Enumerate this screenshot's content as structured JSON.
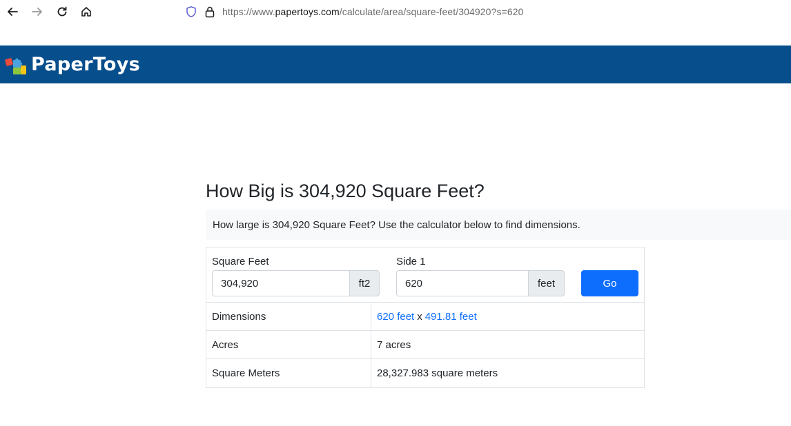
{
  "browser": {
    "url_prefix": "https://www.",
    "url_host": "papertoys.com",
    "url_path": "/calculate/area/square-feet/304920?s=620",
    "icons": [
      "back-arrow-icon",
      "forward-arrow-icon",
      "reload-icon",
      "home-icon",
      "shield-icon",
      "lock-icon"
    ]
  },
  "header": {
    "logo_text": "PaperToys",
    "background_color": "#074e8c"
  },
  "main": {
    "title": "How Big is 304,920 Square Feet?",
    "lead": "How large is 304,920 Square Feet? Use the calculator below to find dimensions."
  },
  "calculator": {
    "area_label": "Square Feet",
    "area_value": "304,920",
    "area_unit": "ft2",
    "side_label": "Side 1",
    "side_value": "620",
    "side_unit": "feet",
    "go_label": "Go",
    "accent_color": "#0d6efd"
  },
  "results": {
    "dimensions_label": "Dimensions",
    "dimension_a": "620 feet",
    "separator": "x",
    "dimension_b": "491.81 feet",
    "acres_label": "Acres",
    "acres_value": "7 acres",
    "sqm_label": "Square Meters",
    "sqm_value": "28,327.983 square meters"
  }
}
